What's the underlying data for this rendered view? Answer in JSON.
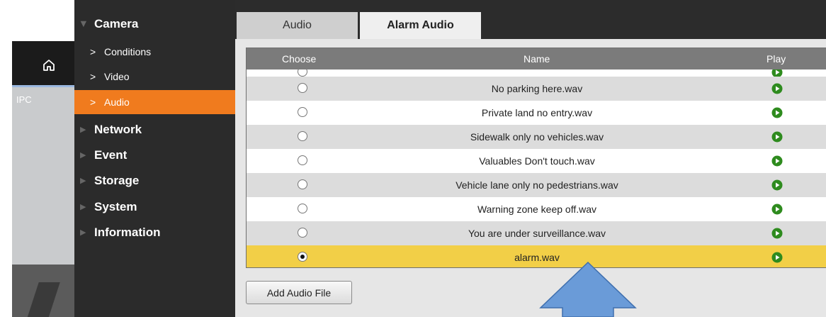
{
  "preview": {
    "label": "IPC"
  },
  "sidebar": {
    "camera": {
      "label": "Camera"
    },
    "camera_subitems": [
      {
        "label": "Conditions"
      },
      {
        "label": "Video"
      },
      {
        "label": "Audio",
        "active": true
      }
    ],
    "sections": [
      {
        "label": "Network"
      },
      {
        "label": "Event"
      },
      {
        "label": "Storage"
      },
      {
        "label": "System"
      },
      {
        "label": "Information"
      }
    ]
  },
  "tabs": [
    {
      "label": "Audio",
      "active": false
    },
    {
      "label": "Alarm Audio",
      "active": true
    }
  ],
  "table": {
    "headers": {
      "choose": "Choose",
      "name": "Name",
      "play": "Play"
    },
    "rows": [
      {
        "name": "No parking here.wav",
        "selected": false
      },
      {
        "name": "Private land no entry.wav",
        "selected": false
      },
      {
        "name": "Sidewalk only no vehicles.wav",
        "selected": false
      },
      {
        "name": "Valuables Don't touch.wav",
        "selected": false
      },
      {
        "name": "Vehicle lane only no pedestrians.wav",
        "selected": false
      },
      {
        "name": "Warning zone keep off.wav",
        "selected": false
      },
      {
        "name": "You are under surveillance.wav",
        "selected": false
      },
      {
        "name": "alarm.wav",
        "selected": true
      }
    ]
  },
  "buttons": {
    "add_audio_file": "Add Audio File"
  },
  "colors": {
    "accent_orange": "#f07b1e",
    "selected_row": "#f2cf47",
    "play_green": "#2e8b1e",
    "annotation_arrow": "#6a9bd8"
  }
}
